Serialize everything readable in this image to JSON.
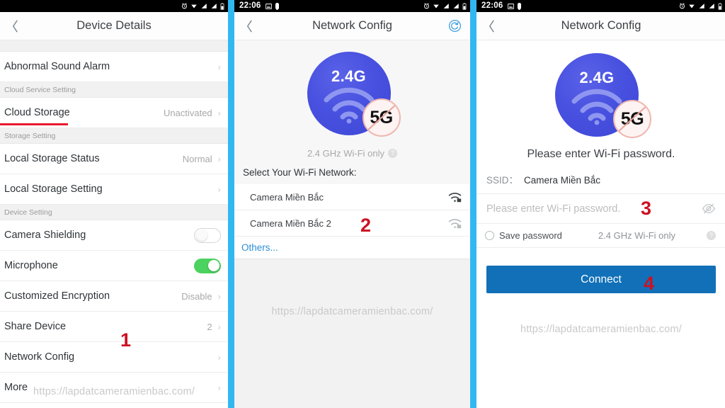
{
  "status_bar": {
    "time": "22:06",
    "left_icons": [
      "gallery-icon",
      "shield-icon"
    ],
    "right_icons": [
      "alarm-icon",
      "signal-wifi-icon",
      "signal-bars-icon",
      "signal-bars-2-icon",
      "battery-icon"
    ]
  },
  "watermark": "https://lapdatcameramienbac.com/",
  "colors": {
    "frame_blue": "#32b8f0",
    "accent_blue": "#1170b8",
    "link_blue": "#2a8fd6",
    "toggle_on_green": "#4cd25f",
    "annotation_red": "#cc1122",
    "underline_red": "#e8192c",
    "disc_blue": "#4750df"
  },
  "panel_left": {
    "nav": {
      "back": "‹",
      "title": "Device Details"
    },
    "rows": [
      {
        "type": "item",
        "label": "Abnormal Sound Alarm",
        "value": "",
        "chevron": "›"
      },
      {
        "type": "section",
        "label": "Cloud Service Setting"
      },
      {
        "type": "item",
        "label": "Cloud Storage",
        "value": "Unactivated",
        "chevron": "›",
        "underlined": true
      },
      {
        "type": "section",
        "label": "Storage Setting"
      },
      {
        "type": "item",
        "label": "Local Storage Status",
        "value": "Normal",
        "chevron": "›"
      },
      {
        "type": "item",
        "label": "Local Storage Setting",
        "value": "",
        "chevron": "›"
      },
      {
        "type": "section",
        "label": "Device Setting"
      },
      {
        "type": "toggle",
        "label": "Camera Shielding",
        "state": "off"
      },
      {
        "type": "toggle",
        "label": "Microphone",
        "state": "on"
      },
      {
        "type": "item",
        "label": "Customized Encryption",
        "value": "Disable",
        "chevron": "›"
      },
      {
        "type": "item",
        "label": "Share Device",
        "value": "2",
        "chevron": "›"
      },
      {
        "type": "item",
        "label": "Network Config",
        "value": "",
        "chevron": "›"
      },
      {
        "type": "item",
        "label": "More",
        "value": "",
        "chevron": "›"
      }
    ],
    "step_number": "1"
  },
  "panel_mid": {
    "nav": {
      "back": "‹",
      "title": "Network Config",
      "action_icon": "refresh-icon"
    },
    "hero": {
      "disc_label": "2.4G",
      "badge_label": "5G",
      "caption": "2.4 GHz Wi-Fi only",
      "help": "?"
    },
    "select_label": "Select Your Wi-Fi Network:",
    "networks": [
      {
        "name": "Camera Miền Bắc",
        "icon": "wifi-lock-icon",
        "secured": true
      },
      {
        "name": "Camera Miền Bắc 2",
        "icon": "wifi-lock-icon",
        "secured": true
      }
    ],
    "others_label": "Others...",
    "step_number": "2"
  },
  "panel_right": {
    "nav": {
      "back": "‹",
      "title": "Network Config"
    },
    "hero": {
      "disc_label": "2.4G",
      "badge_label": "5G"
    },
    "hint": "Please enter Wi-Fi password.",
    "ssid_key": "SSID：",
    "ssid_value": "Camera Miền Bắc",
    "password_placeholder": "Please enter Wi-Fi password.",
    "password_value": "",
    "eye_icon": "eye-slash-icon",
    "save_password_label": "Save password",
    "band_label": "2.4 GHz Wi-Fi only",
    "help": "?",
    "connect_label": "Connect",
    "step_number_password": "3",
    "step_number_connect": "4"
  }
}
